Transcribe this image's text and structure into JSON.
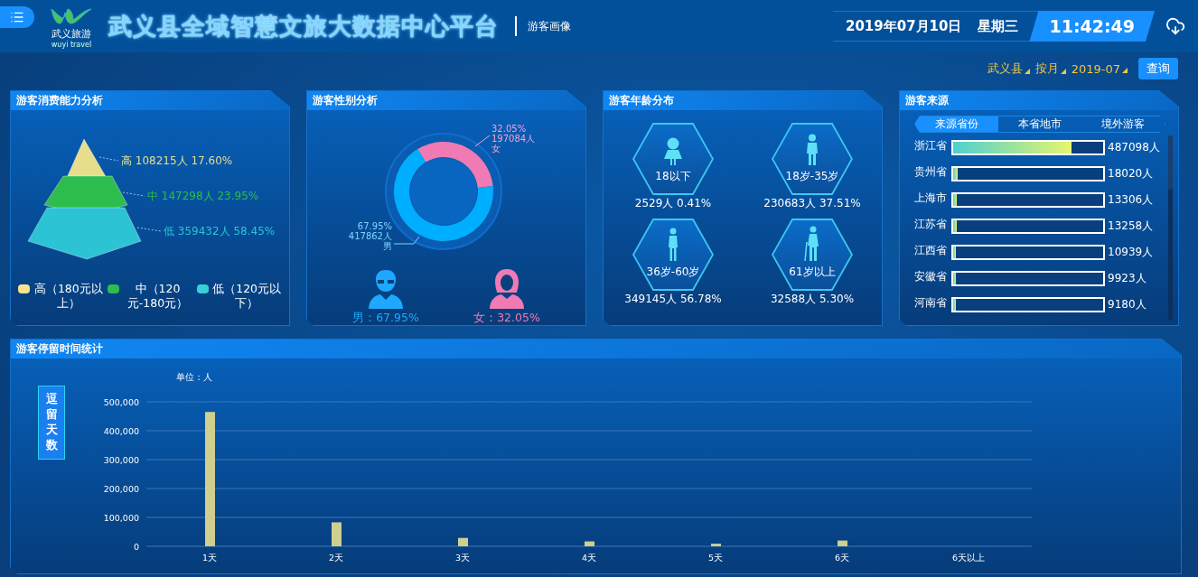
{
  "header": {
    "logo": {
      "name": "武义旅游",
      "subtitle": "wuyi travel"
    },
    "title": "武义县全域智慧文旅大数据中心平台",
    "subtitle": "游客画像",
    "date": "2019年07月10日",
    "weekday": "星期三",
    "time": "11:42:49"
  },
  "filters": [
    {
      "label": "武义县"
    },
    {
      "label": "按月"
    },
    {
      "label": "2019-07"
    }
  ],
  "query_button": "查询",
  "consumption": {
    "title": "游客消费能力分析",
    "tiers": [
      {
        "name": "高",
        "count": "108215人",
        "percent": "17.60%",
        "color": "#e6de8c"
      },
      {
        "name": "中",
        "count": "147298人",
        "percent": "23.95%",
        "color": "#2dbd4e"
      },
      {
        "name": "低",
        "count": "359432人",
        "percent": "58.45%",
        "color": "#2cc4d4"
      }
    ],
    "legend": [
      {
        "label": "高（180元以上）",
        "color": "#f8e38a"
      },
      {
        "label": "中（120元-180元）",
        "color": "#2dbd4e"
      },
      {
        "label": "低（120元以下）",
        "color": "#36d1d6"
      }
    ]
  },
  "gender": {
    "title": "游客性别分析",
    "chart_data": {
      "type": "donut",
      "categories": [
        "女",
        "男"
      ],
      "values": [
        32.05,
        67.95
      ],
      "colors": [
        "#f07ab4",
        "#00aeff"
      ],
      "value_labels": [
        [
          "32.05%",
          "197084人"
        ],
        [
          "67.95%",
          "417862人"
        ]
      ]
    },
    "people": [
      {
        "kind": "male",
        "label": "男：67.95%",
        "color": "#1ea8ff"
      },
      {
        "kind": "female",
        "label": "女：32.05%",
        "color": "#f07ab4"
      }
    ]
  },
  "age": {
    "title": "游客年龄分布",
    "groups": [
      {
        "kind": "child",
        "label": "18以下",
        "stat": "2529人 0.41%"
      },
      {
        "kind": "youth",
        "label": "18岁-35岁",
        "stat": "230683人 37.51%"
      },
      {
        "kind": "adult",
        "label": "36岁-60岁",
        "stat": "349145人 56.78%"
      },
      {
        "kind": "elder",
        "label": "61岁以上",
        "stat": "32588人 5.30%"
      }
    ]
  },
  "source": {
    "title": "游客来源",
    "tabs": [
      {
        "label": "来源省份",
        "selected": true
      },
      {
        "label": "本省地市",
        "selected": false
      },
      {
        "label": "境外游客",
        "selected": false
      }
    ],
    "rows": [
      {
        "name": "浙江省",
        "level": 0.79,
        "value": "487098人"
      },
      {
        "name": "贵州省",
        "level": 0.03,
        "value": "18020人"
      },
      {
        "name": "上海市",
        "level": 0.025,
        "value": "13306人"
      },
      {
        "name": "江苏省",
        "level": 0.025,
        "value": "13258人"
      },
      {
        "name": "江西省",
        "level": 0.02,
        "value": "10939人"
      },
      {
        "name": "安徽省",
        "level": 0.02,
        "value": "9923人"
      },
      {
        "name": "河南省",
        "level": 0.018,
        "value": "9180人"
      }
    ]
  },
  "stay": {
    "title": "游客停留时间统计",
    "side_label": "逗留天数",
    "unit": "单位：人",
    "chart_data": {
      "type": "bar",
      "categories": [
        "1天",
        "2天",
        "3天",
        "4天",
        "5天",
        "6天",
        "6天以上"
      ],
      "values": [
        465000,
        83000,
        29000,
        17000,
        9000,
        20000,
        0
      ],
      "grid": true,
      "ylim": [
        0,
        500000
      ],
      "yticks": [
        {
          "value": 0,
          "label": "0"
        },
        {
          "value": 100000,
          "label": "100,000"
        },
        {
          "value": 200000,
          "label": "200,000"
        },
        {
          "value": 300000,
          "label": "300,000"
        },
        {
          "value": 400000,
          "label": "400,000"
        },
        {
          "value": 500000,
          "label": "500,000"
        }
      ]
    }
  }
}
